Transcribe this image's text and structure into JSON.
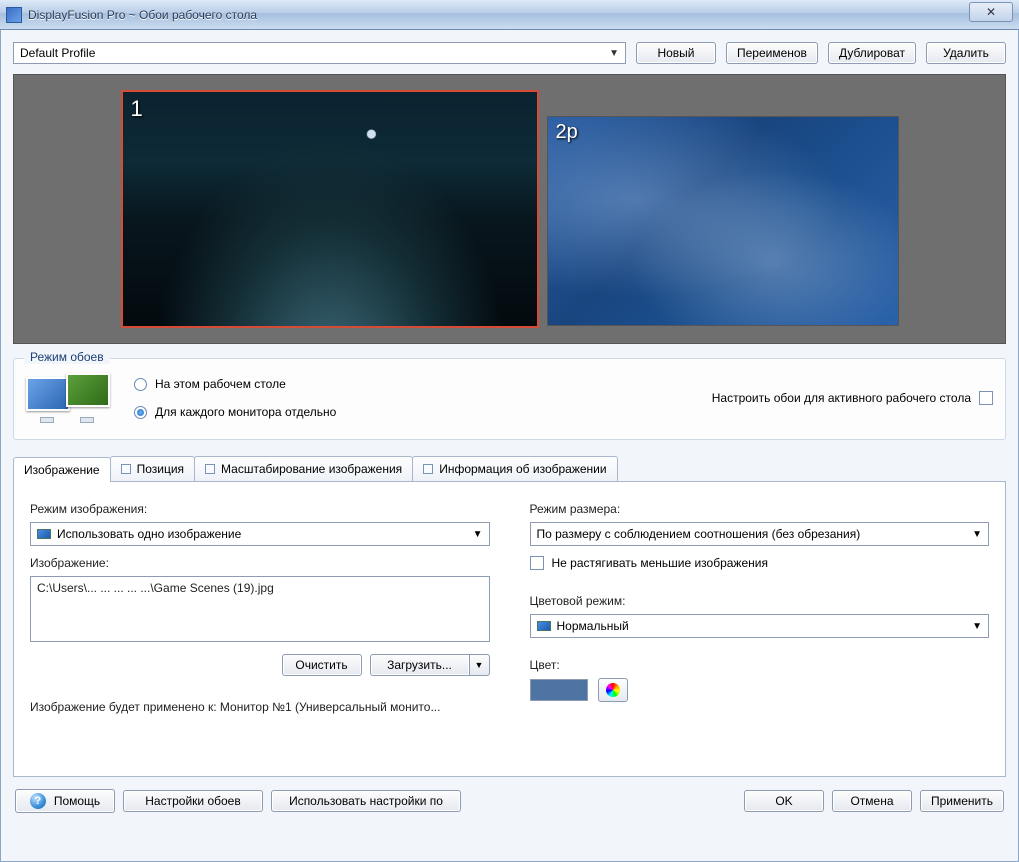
{
  "window": {
    "title": "DisplayFusion Pro ~ Обои рабочего стола",
    "close_glyph": "✕"
  },
  "profile": {
    "selected": "Default Profile",
    "buttons": {
      "new": "Новый",
      "rename": "Переименов",
      "duplicate": "Дублироват",
      "delete": "Удалить"
    }
  },
  "preview": {
    "mon1_label": "1",
    "mon2_label": "2p"
  },
  "mode_group": {
    "legend": "Режим обоев",
    "opt_this_desktop": "На этом рабочем столе",
    "opt_each_monitor": "Для каждого монитора отдельно",
    "opt_active_desktop": "Настроить обои для активного рабочего стола",
    "selected": "each"
  },
  "tabs": {
    "image": "Изображение",
    "position": "Позиция",
    "scaling": "Масштабирование изображения",
    "info": "Информация об изображении"
  },
  "image_tab": {
    "mode_label": "Режим изображения:",
    "mode_value": "Использовать одно изображение",
    "path_label": "Изображение:",
    "path_value": "C:\\Users\\... ... ... ... ...\\Game Scenes (19).jpg",
    "clear": "Очистить",
    "load": "Загрузить...",
    "size_label": "Режим размера:",
    "size_value": "По размеру с соблюдением соотношения (без обрезания)",
    "no_stretch": "Не растягивать меньшие изображения",
    "colormode_label": "Цветовой режим:",
    "colormode_value": "Нормальный",
    "color_label": "Цвет:",
    "applies_to": "Изображение будет применено к: Монитор №1 (Универсальный монито..."
  },
  "bottom": {
    "help": "Помощь",
    "settings": "Настройки обоев",
    "defaults": "Использовать настройки по",
    "ok": "OK",
    "cancel": "Отмена",
    "apply": "Применить"
  }
}
